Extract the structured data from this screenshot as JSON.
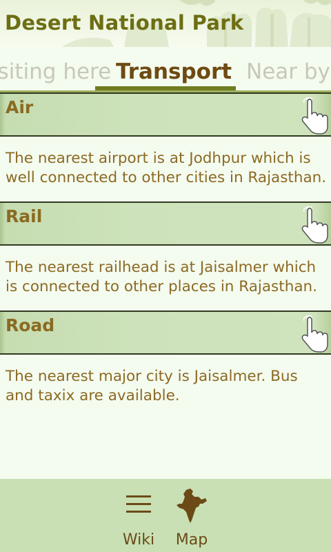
{
  "header": {
    "title": "Desert National Park"
  },
  "tabs": {
    "prev": "isiting here",
    "active": "Transport",
    "next": "Near by"
  },
  "sections": [
    {
      "title": "Air",
      "text": "The nearest airport is at Jodhpur which is well connected to other cities in Rajasthan."
    },
    {
      "title": "Rail",
      "text": "The nearest railhead is at Jaisalmer which is connected to other places in Rajasthan."
    },
    {
      "title": "Road",
      "text": "The nearest major city is Jaisalmer. Bus and taxix are available."
    }
  ],
  "bottom_bar": {
    "wiki_label": "Wiki",
    "map_label": "Map"
  },
  "colors": {
    "title": "#6d6e13",
    "active_tab": "#6e4a12",
    "section_header_bg": "#cde2ba",
    "body_text": "#8c6a24",
    "bottom_bar_bg": "#c9e0b5"
  },
  "icons": {
    "section_action": "tap-hand-icon",
    "wiki": "menu-lines-icon",
    "map": "india-map-icon"
  }
}
